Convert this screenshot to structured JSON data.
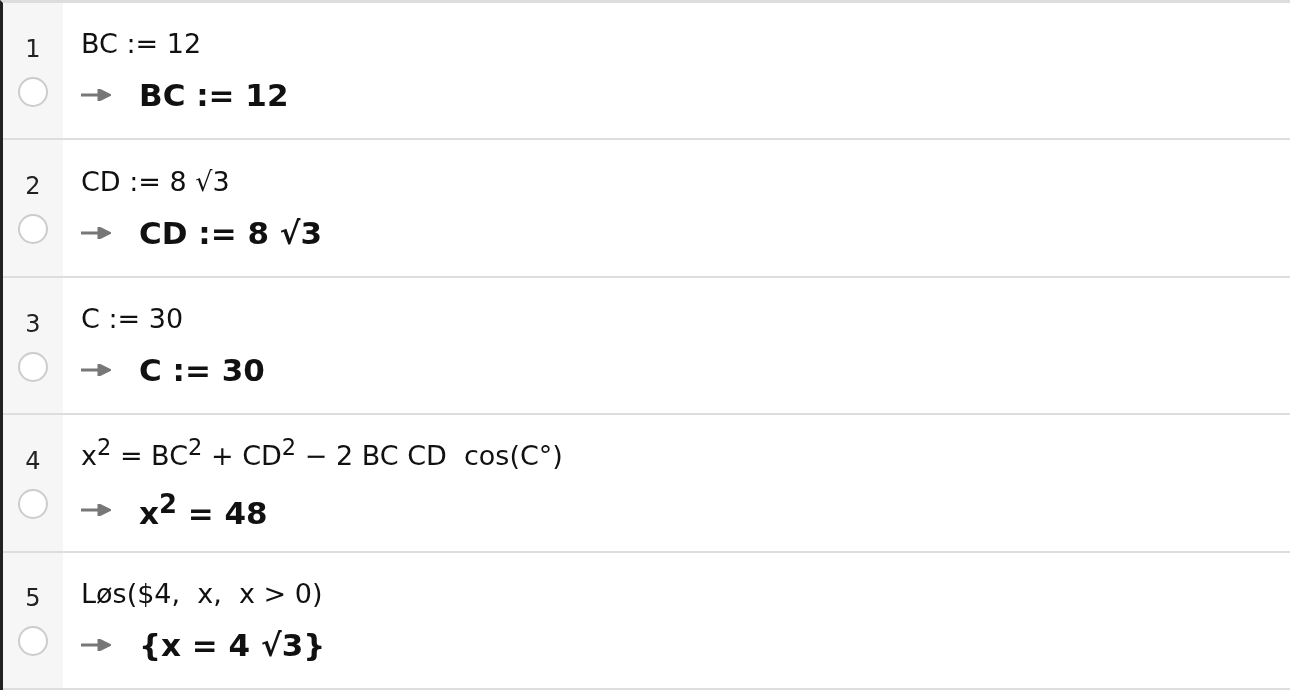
{
  "cells": [
    {
      "number": "1",
      "shown": false,
      "input": "BC := 12",
      "output": "BC := 12"
    },
    {
      "number": "2",
      "shown": false,
      "input": "CD := 8 √3",
      "output": "CD := 8 √3"
    },
    {
      "number": "3",
      "shown": false,
      "input": "C := 30",
      "output": "C := 30"
    },
    {
      "number": "4",
      "shown": false,
      "input": "x$^{2}$ = BC$^{2}$ + CD$^{2}$ − 2 BC CD  cos(C°)",
      "output": "x$^{2}$ = 48"
    },
    {
      "number": "5",
      "shown": false,
      "input": "Løs($4,  x,  x > 0)",
      "output": "{x = 4 √3}"
    }
  ]
}
